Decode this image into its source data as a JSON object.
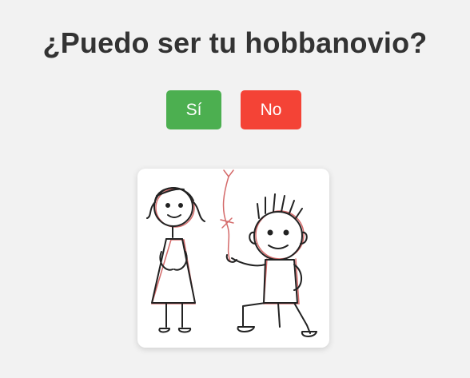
{
  "page": {
    "title": "¿Puedo ser tu hobbanovio?"
  },
  "buttons": {
    "yes_label": "Sí",
    "no_label": "No"
  },
  "colors": {
    "background": "#f2f2f2",
    "title": "#333333",
    "yes_button": "#4caf50",
    "no_button": "#f44336"
  },
  "image": {
    "icon": "couple-proposal-illustration"
  }
}
